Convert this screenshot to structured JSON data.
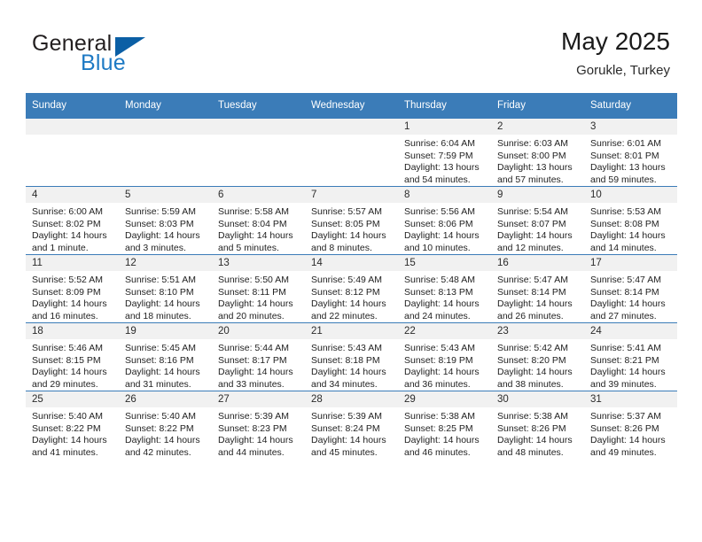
{
  "brand": {
    "name_part1": "General",
    "name_part2": "Blue",
    "triangle_color": "#0b5fa5",
    "blue_text_color": "#1e7ac4"
  },
  "header": {
    "title": "May 2025",
    "location": "Gorukle, Turkey",
    "header_bg_color": "#3b7cb8",
    "daynum_bg_color": "#f1f1f1"
  },
  "weekday_headers": [
    "Sunday",
    "Monday",
    "Tuesday",
    "Wednesday",
    "Thursday",
    "Friday",
    "Saturday"
  ],
  "weeks": [
    [
      {
        "day": "",
        "empty": true,
        "sunrise": "",
        "sunset": "",
        "daylight_line1": "",
        "daylight_line2": ""
      },
      {
        "day": "",
        "empty": true,
        "sunrise": "",
        "sunset": "",
        "daylight_line1": "",
        "daylight_line2": ""
      },
      {
        "day": "",
        "empty": true,
        "sunrise": "",
        "sunset": "",
        "daylight_line1": "",
        "daylight_line2": ""
      },
      {
        "day": "",
        "empty": true,
        "sunrise": "",
        "sunset": "",
        "daylight_line1": "",
        "daylight_line2": ""
      },
      {
        "day": "1",
        "empty": false,
        "sunrise": "Sunrise: 6:04 AM",
        "sunset": "Sunset: 7:59 PM",
        "daylight_line1": "Daylight: 13 hours",
        "daylight_line2": "and 54 minutes."
      },
      {
        "day": "2",
        "empty": false,
        "sunrise": "Sunrise: 6:03 AM",
        "sunset": "Sunset: 8:00 PM",
        "daylight_line1": "Daylight: 13 hours",
        "daylight_line2": "and 57 minutes."
      },
      {
        "day": "3",
        "empty": false,
        "sunrise": "Sunrise: 6:01 AM",
        "sunset": "Sunset: 8:01 PM",
        "daylight_line1": "Daylight: 13 hours",
        "daylight_line2": "and 59 minutes."
      }
    ],
    [
      {
        "day": "4",
        "empty": false,
        "sunrise": "Sunrise: 6:00 AM",
        "sunset": "Sunset: 8:02 PM",
        "daylight_line1": "Daylight: 14 hours",
        "daylight_line2": "and 1 minute."
      },
      {
        "day": "5",
        "empty": false,
        "sunrise": "Sunrise: 5:59 AM",
        "sunset": "Sunset: 8:03 PM",
        "daylight_line1": "Daylight: 14 hours",
        "daylight_line2": "and 3 minutes."
      },
      {
        "day": "6",
        "empty": false,
        "sunrise": "Sunrise: 5:58 AM",
        "sunset": "Sunset: 8:04 PM",
        "daylight_line1": "Daylight: 14 hours",
        "daylight_line2": "and 5 minutes."
      },
      {
        "day": "7",
        "empty": false,
        "sunrise": "Sunrise: 5:57 AM",
        "sunset": "Sunset: 8:05 PM",
        "daylight_line1": "Daylight: 14 hours",
        "daylight_line2": "and 8 minutes."
      },
      {
        "day": "8",
        "empty": false,
        "sunrise": "Sunrise: 5:56 AM",
        "sunset": "Sunset: 8:06 PM",
        "daylight_line1": "Daylight: 14 hours",
        "daylight_line2": "and 10 minutes."
      },
      {
        "day": "9",
        "empty": false,
        "sunrise": "Sunrise: 5:54 AM",
        "sunset": "Sunset: 8:07 PM",
        "daylight_line1": "Daylight: 14 hours",
        "daylight_line2": "and 12 minutes."
      },
      {
        "day": "10",
        "empty": false,
        "sunrise": "Sunrise: 5:53 AM",
        "sunset": "Sunset: 8:08 PM",
        "daylight_line1": "Daylight: 14 hours",
        "daylight_line2": "and 14 minutes."
      }
    ],
    [
      {
        "day": "11",
        "empty": false,
        "sunrise": "Sunrise: 5:52 AM",
        "sunset": "Sunset: 8:09 PM",
        "daylight_line1": "Daylight: 14 hours",
        "daylight_line2": "and 16 minutes."
      },
      {
        "day": "12",
        "empty": false,
        "sunrise": "Sunrise: 5:51 AM",
        "sunset": "Sunset: 8:10 PM",
        "daylight_line1": "Daylight: 14 hours",
        "daylight_line2": "and 18 minutes."
      },
      {
        "day": "13",
        "empty": false,
        "sunrise": "Sunrise: 5:50 AM",
        "sunset": "Sunset: 8:11 PM",
        "daylight_line1": "Daylight: 14 hours",
        "daylight_line2": "and 20 minutes."
      },
      {
        "day": "14",
        "empty": false,
        "sunrise": "Sunrise: 5:49 AM",
        "sunset": "Sunset: 8:12 PM",
        "daylight_line1": "Daylight: 14 hours",
        "daylight_line2": "and 22 minutes."
      },
      {
        "day": "15",
        "empty": false,
        "sunrise": "Sunrise: 5:48 AM",
        "sunset": "Sunset: 8:13 PM",
        "daylight_line1": "Daylight: 14 hours",
        "daylight_line2": "and 24 minutes."
      },
      {
        "day": "16",
        "empty": false,
        "sunrise": "Sunrise: 5:47 AM",
        "sunset": "Sunset: 8:14 PM",
        "daylight_line1": "Daylight: 14 hours",
        "daylight_line2": "and 26 minutes."
      },
      {
        "day": "17",
        "empty": false,
        "sunrise": "Sunrise: 5:47 AM",
        "sunset": "Sunset: 8:14 PM",
        "daylight_line1": "Daylight: 14 hours",
        "daylight_line2": "and 27 minutes."
      }
    ],
    [
      {
        "day": "18",
        "empty": false,
        "sunrise": "Sunrise: 5:46 AM",
        "sunset": "Sunset: 8:15 PM",
        "daylight_line1": "Daylight: 14 hours",
        "daylight_line2": "and 29 minutes."
      },
      {
        "day": "19",
        "empty": false,
        "sunrise": "Sunrise: 5:45 AM",
        "sunset": "Sunset: 8:16 PM",
        "daylight_line1": "Daylight: 14 hours",
        "daylight_line2": "and 31 minutes."
      },
      {
        "day": "20",
        "empty": false,
        "sunrise": "Sunrise: 5:44 AM",
        "sunset": "Sunset: 8:17 PM",
        "daylight_line1": "Daylight: 14 hours",
        "daylight_line2": "and 33 minutes."
      },
      {
        "day": "21",
        "empty": false,
        "sunrise": "Sunrise: 5:43 AM",
        "sunset": "Sunset: 8:18 PM",
        "daylight_line1": "Daylight: 14 hours",
        "daylight_line2": "and 34 minutes."
      },
      {
        "day": "22",
        "empty": false,
        "sunrise": "Sunrise: 5:43 AM",
        "sunset": "Sunset: 8:19 PM",
        "daylight_line1": "Daylight: 14 hours",
        "daylight_line2": "and 36 minutes."
      },
      {
        "day": "23",
        "empty": false,
        "sunrise": "Sunrise: 5:42 AM",
        "sunset": "Sunset: 8:20 PM",
        "daylight_line1": "Daylight: 14 hours",
        "daylight_line2": "and 38 minutes."
      },
      {
        "day": "24",
        "empty": false,
        "sunrise": "Sunrise: 5:41 AM",
        "sunset": "Sunset: 8:21 PM",
        "daylight_line1": "Daylight: 14 hours",
        "daylight_line2": "and 39 minutes."
      }
    ],
    [
      {
        "day": "25",
        "empty": false,
        "sunrise": "Sunrise: 5:40 AM",
        "sunset": "Sunset: 8:22 PM",
        "daylight_line1": "Daylight: 14 hours",
        "daylight_line2": "and 41 minutes."
      },
      {
        "day": "26",
        "empty": false,
        "sunrise": "Sunrise: 5:40 AM",
        "sunset": "Sunset: 8:22 PM",
        "daylight_line1": "Daylight: 14 hours",
        "daylight_line2": "and 42 minutes."
      },
      {
        "day": "27",
        "empty": false,
        "sunrise": "Sunrise: 5:39 AM",
        "sunset": "Sunset: 8:23 PM",
        "daylight_line1": "Daylight: 14 hours",
        "daylight_line2": "and 44 minutes."
      },
      {
        "day": "28",
        "empty": false,
        "sunrise": "Sunrise: 5:39 AM",
        "sunset": "Sunset: 8:24 PM",
        "daylight_line1": "Daylight: 14 hours",
        "daylight_line2": "and 45 minutes."
      },
      {
        "day": "29",
        "empty": false,
        "sunrise": "Sunrise: 5:38 AM",
        "sunset": "Sunset: 8:25 PM",
        "daylight_line1": "Daylight: 14 hours",
        "daylight_line2": "and 46 minutes."
      },
      {
        "day": "30",
        "empty": false,
        "sunrise": "Sunrise: 5:38 AM",
        "sunset": "Sunset: 8:26 PM",
        "daylight_line1": "Daylight: 14 hours",
        "daylight_line2": "and 48 minutes."
      },
      {
        "day": "31",
        "empty": false,
        "sunrise": "Sunrise: 5:37 AM",
        "sunset": "Sunset: 8:26 PM",
        "daylight_line1": "Daylight: 14 hours",
        "daylight_line2": "and 49 minutes."
      }
    ]
  ]
}
